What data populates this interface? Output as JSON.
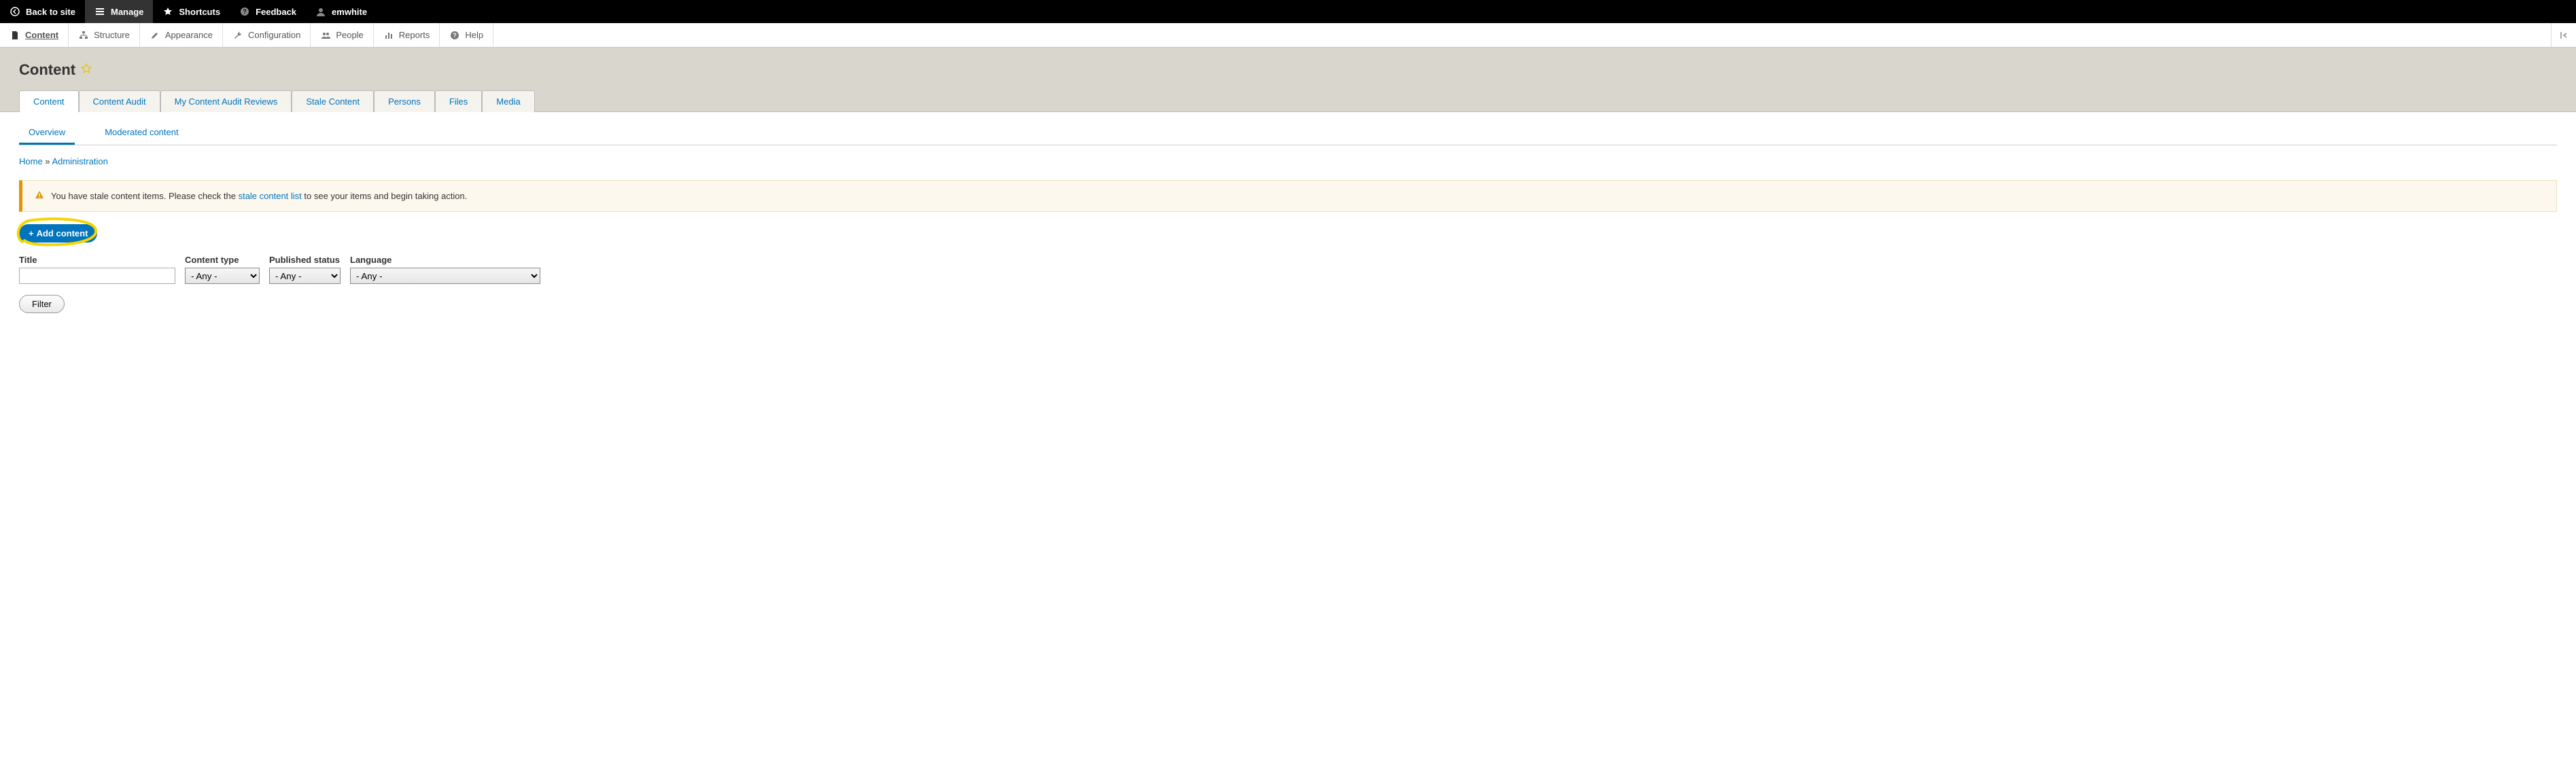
{
  "topbar": {
    "back": "Back to site",
    "manage": "Manage",
    "shortcuts": "Shortcuts",
    "feedback": "Feedback",
    "user": "emwhite"
  },
  "adminmenu": {
    "content": "Content",
    "structure": "Structure",
    "appearance": "Appearance",
    "configuration": "Configuration",
    "people": "People",
    "reports": "Reports",
    "help": "Help"
  },
  "page": {
    "title": "Content"
  },
  "tabs": {
    "content": "Content",
    "content_audit": "Content Audit",
    "my_reviews": "My Content Audit Reviews",
    "stale": "Stale Content",
    "persons": "Persons",
    "files": "Files",
    "media": "Media"
  },
  "subtabs": {
    "overview": "Overview",
    "moderated": "Moderated content"
  },
  "breadcrumb": {
    "home": "Home",
    "sep": " » ",
    "admin": "Administration"
  },
  "warning": {
    "pre": "You have stale content items. Please check the ",
    "link": "stale content list",
    "post": " to see your items and begin taking action."
  },
  "actions": {
    "add_content": "Add content"
  },
  "filters": {
    "title_label": "Title",
    "title_value": "",
    "ct_label": "Content type",
    "ct_value": "- Any -",
    "ps_label": "Published status",
    "ps_value": "- Any -",
    "lang_label": "Language",
    "lang_value": "- Any -",
    "filter_btn": "Filter"
  }
}
